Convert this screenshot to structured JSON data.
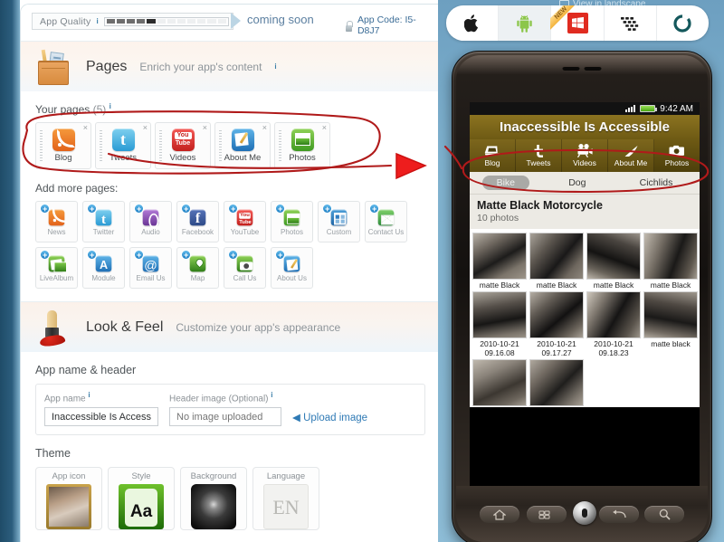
{
  "builder": {
    "quality": {
      "label": "App Quality",
      "info": "i",
      "segments_total": 12,
      "segments_filled": 5,
      "status": "coming soon"
    },
    "app_code": {
      "label": "App Code: I5-D8J7",
      "icon": "lock-icon"
    },
    "pages_section": {
      "icon": "toolbag-icon",
      "title": "Pages",
      "subtitle": "Enrich your app's content",
      "info": "i",
      "your_pages_label": "Your pages",
      "your_pages_count": "(5)",
      "your_pages": [
        {
          "label": "Blog",
          "icon": "rss-icon",
          "close": "×"
        },
        {
          "label": "Tweets",
          "icon": "twitter-icon",
          "close": "×"
        },
        {
          "label": "Videos",
          "icon": "youtube-icon",
          "close": "×"
        },
        {
          "label": "About Me",
          "icon": "notepad-pen-icon",
          "close": "×"
        },
        {
          "label": "Photos",
          "icon": "photo-icon",
          "close": "×"
        }
      ],
      "add_more_label": "Add more pages:",
      "add_more": [
        {
          "label": "News",
          "icon": "rss-icon"
        },
        {
          "label": "Twitter",
          "icon": "twitter-icon"
        },
        {
          "label": "Audio",
          "icon": "audio-icon"
        },
        {
          "label": "Facebook",
          "icon": "facebook-icon"
        },
        {
          "label": "YouTube",
          "icon": "youtube-icon"
        },
        {
          "label": "Photos",
          "icon": "photo-icon"
        },
        {
          "label": "Custom",
          "icon": "custom-icon"
        },
        {
          "label": "Contact Us",
          "icon": "contact-icon"
        },
        {
          "label": "LiveAlbum",
          "icon": "livealbum-icon"
        },
        {
          "label": "Module",
          "icon": "module-icon"
        },
        {
          "label": "Email Us",
          "icon": "email-icon"
        },
        {
          "label": "Map",
          "icon": "map-icon"
        },
        {
          "label": "Call Us",
          "icon": "phone-icon"
        },
        {
          "label": "About Us",
          "icon": "notepad-pen-icon"
        }
      ]
    },
    "look_feel_section": {
      "icon": "paintbrush-icon",
      "title": "Look & Feel",
      "subtitle": "Customize your app's appearance",
      "app_name_header_label": "App name & header",
      "app_name_field_label": "App name",
      "app_name_info": "i",
      "app_name_value": "Inaccessible Is Access",
      "header_image_label": "Header image (Optional)",
      "header_image_info": "i",
      "header_image_placeholder": "No image uploaded",
      "upload_link": "Upload image",
      "theme_label": "Theme",
      "theme_tiles": [
        {
          "caption": "App icon",
          "thumb": "portrait-photo"
        },
        {
          "caption": "Style",
          "thumb": "green-aa"
        },
        {
          "caption": "Background",
          "thumb": "dark-galaxy"
        },
        {
          "caption": "Language",
          "thumb": "EN"
        }
      ]
    }
  },
  "preview": {
    "landscape_hint": "View in landscape",
    "platforms": [
      {
        "name": "Apple",
        "icon": "apple-icon",
        "selected": false,
        "badge": ""
      },
      {
        "name": "Android",
        "icon": "android-icon",
        "selected": true,
        "badge": ""
      },
      {
        "name": "Windows Phone",
        "icon": "windows-icon",
        "selected": false,
        "badge": "NEW"
      },
      {
        "name": "BlackBerry",
        "icon": "blackberry-icon",
        "selected": false,
        "badge": ""
      },
      {
        "name": "webOS",
        "icon": "webos-icon",
        "selected": false,
        "badge": ""
      }
    ],
    "status_bar": {
      "clock": "9:42 AM",
      "signal": "signal-icon",
      "battery": "battery-icon"
    },
    "app_title": "Inaccessible Is Accessible",
    "tabs": [
      {
        "label": "Blog",
        "icon": "laptop-icon",
        "active": false
      },
      {
        "label": "Tweets",
        "icon": "twitter-icon",
        "active": false
      },
      {
        "label": "Videos",
        "icon": "video-camera-icon",
        "active": false
      },
      {
        "label": "About Me",
        "icon": "pen-stroke-icon",
        "active": false
      },
      {
        "label": "Photos",
        "icon": "camera-icon",
        "active": true
      }
    ],
    "categories": [
      {
        "label": "Bike",
        "selected": true
      },
      {
        "label": "Dog",
        "selected": false
      },
      {
        "label": "Cichlids",
        "selected": false
      }
    ],
    "album": {
      "title": "Matte Black Motorcycle",
      "count": "10 photos"
    },
    "photos": [
      {
        "caption": "matte Black",
        "shade": "ph-a"
      },
      {
        "caption": "matte Black",
        "shade": "ph-b"
      },
      {
        "caption": "matte Black",
        "shade": "ph-c"
      },
      {
        "caption": "matte Black",
        "shade": "ph-d"
      },
      {
        "caption": "2010-10-21 09.16.08",
        "shade": "ph-e"
      },
      {
        "caption": "2010-10-21 09.17.27",
        "shade": "ph-f"
      },
      {
        "caption": "2010-10-21 09.18.23",
        "shade": "ph-g"
      },
      {
        "caption": "matte black",
        "shade": "ph-h"
      },
      {
        "caption": "",
        "shade": "ph-i"
      },
      {
        "caption": "",
        "shade": "ph-j"
      }
    ],
    "hardware_buttons": [
      {
        "name": "home",
        "icon": "home-icon"
      },
      {
        "name": "menu",
        "icon": "menu-icon"
      },
      {
        "name": "trackball",
        "icon": "trackball-icon"
      },
      {
        "name": "back",
        "icon": "back-arrow-icon"
      },
      {
        "name": "search",
        "icon": "search-icon"
      }
    ]
  },
  "annotations": {
    "color": "#b01a1a",
    "marks": [
      "oval-around-your-pages",
      "arrow-to-phone-tabbar",
      "oval-around-phone-tabbar"
    ]
  }
}
